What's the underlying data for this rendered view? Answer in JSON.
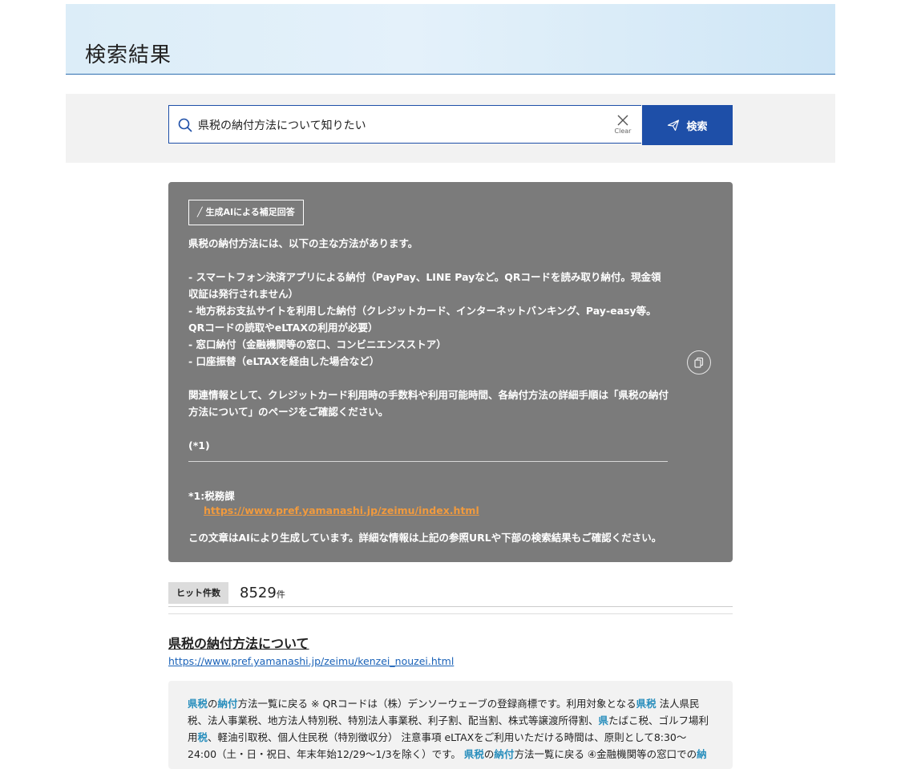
{
  "page": {
    "title": "検索結果"
  },
  "search": {
    "query": "県税の納付方法について知りたい",
    "clear_label": "Clear",
    "button_label": "検索"
  },
  "ai_answer": {
    "badge": "╱ 生成AIによる補足回答",
    "body": "県税の納付方法には、以下の主な方法があります。\n\n- スマートフォン決済アプリによる納付（PayPay、LINE Payなど。QRコードを読み取り納付。現金領収証は発行されません）\n- 地方税お支払サイトを利用した納付（クレジットカード、インターネットバンキング、Pay-easy等。QRコードの読取やeLTAXの利用が必要）\n- 窓口納付（金融機関等の窓口、コンビニエンスストア）\n- 口座振替（eLTAXを経由した場合など）\n\n関連情報として、クレジットカード利用時の手数料や利用可能時間、各納付方法の詳細手順は「県税の納付方法について」のページをご確認ください。\n\n(*1)",
    "reference_label": "*1:税務課",
    "reference_url": "https://www.pref.yamanashi.jp/zeimu/index.html",
    "note": "この文章はAIにより生成しています。詳細な情報は上記の参照URLや下部の検索結果もご確認ください。"
  },
  "hits": {
    "label": "ヒット件数",
    "count": "8529",
    "unit": "件"
  },
  "results": [
    {
      "title": "県税の納付方法について",
      "url": "https://www.pref.yamanashi.jp/zeimu/kenzei_nouzei.html",
      "snippet": [
        {
          "t": "県税",
          "h": true
        },
        {
          "t": "の",
          "h": false
        },
        {
          "t": "納付",
          "h": true
        },
        {
          "t": "方法一覧に戻る ※ QRコードは（株）デンソーウェーブの登録商標です。利用対象となる",
          "h": false
        },
        {
          "t": "県税",
          "h": true
        },
        {
          "t": " 法人県民税、法人事業税、地方法人特別税、特別法人事業税、利子割、配当割、株式等譲渡所得割、",
          "h": false
        },
        {
          "t": "県",
          "h": true
        },
        {
          "t": "たばこ税、ゴルフ場利用",
          "h": false
        },
        {
          "t": "税",
          "h": true
        },
        {
          "t": "、軽油引取税、個人住民税（特別徴収分） 注意事項 eLTAXをご利用いただける時間は、原則として8:30〜24:00（土・日・祝日、年末年始12/29〜1/3を除く）です。 ",
          "h": false
        },
        {
          "t": "県税",
          "h": true
        },
        {
          "t": "の",
          "h": false
        },
        {
          "t": "納付",
          "h": true
        },
        {
          "t": "方法一覧に戻る ④金融機関等の窓口での",
          "h": false
        },
        {
          "t": "納",
          "h": true
        }
      ]
    }
  ],
  "colors": {
    "primary": "#1e4fa8",
    "ai_panel": "#7b7b7b",
    "highlight": "#2a8fbd",
    "reference_link": "#f09a3e"
  }
}
